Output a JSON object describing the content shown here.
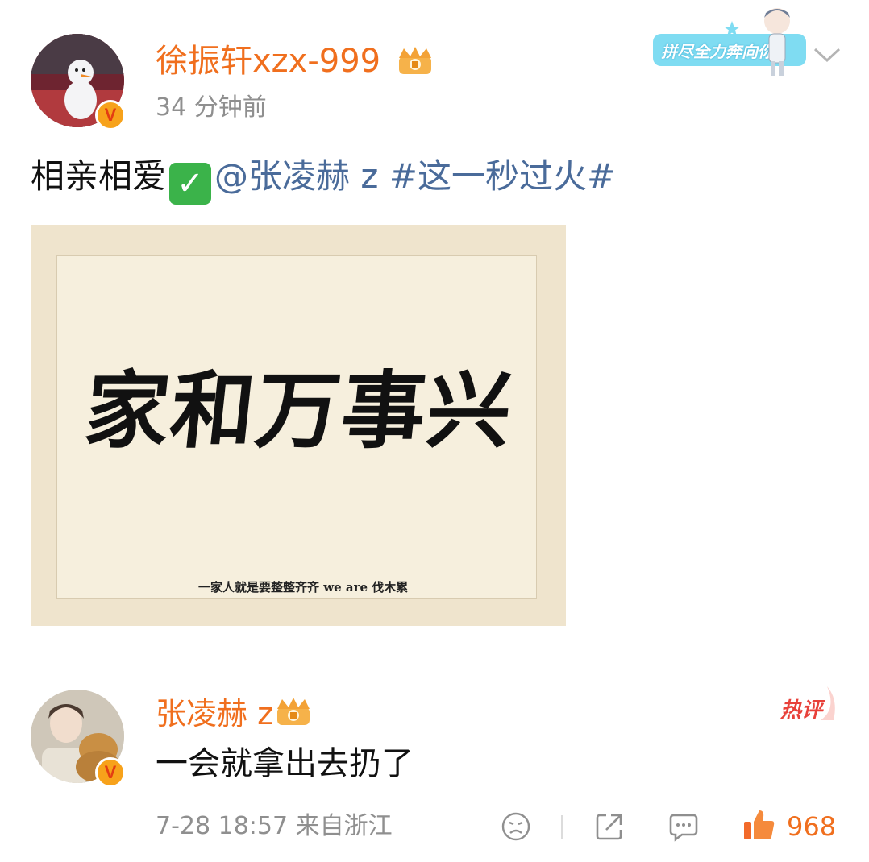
{
  "post": {
    "author": "徐振轩xzx-999",
    "time": "34 分钟前",
    "sticker_text": "拼尽全力奔向你",
    "text_plain": "相亲相爱",
    "mention": "@张凌赫 z",
    "hashtag": "#这一秒过火#",
    "image": {
      "calligraphy": "家和万事兴",
      "caption": "一家人就是要整整齐齐 we are 伐木累"
    }
  },
  "comment": {
    "author": "张凌赫 z",
    "hot_label": "热评",
    "text": "一会就拿出去扔了",
    "meta": "7-28 18:57  来自浙江",
    "likes": "968"
  },
  "colors": {
    "username": "#f06f1e",
    "link": "#4a6b9a",
    "meta": "#8f8f8f",
    "hot": "#e8413a"
  },
  "icons": {
    "verified": "verified-v-badge",
    "crown": "vip-crown-icon",
    "dropdown": "chevron-down-icon",
    "check": "check-mark-emoji",
    "sad": "sad-face-icon",
    "share": "share-icon",
    "comment": "comment-icon",
    "like": "thumbs-up-icon"
  }
}
